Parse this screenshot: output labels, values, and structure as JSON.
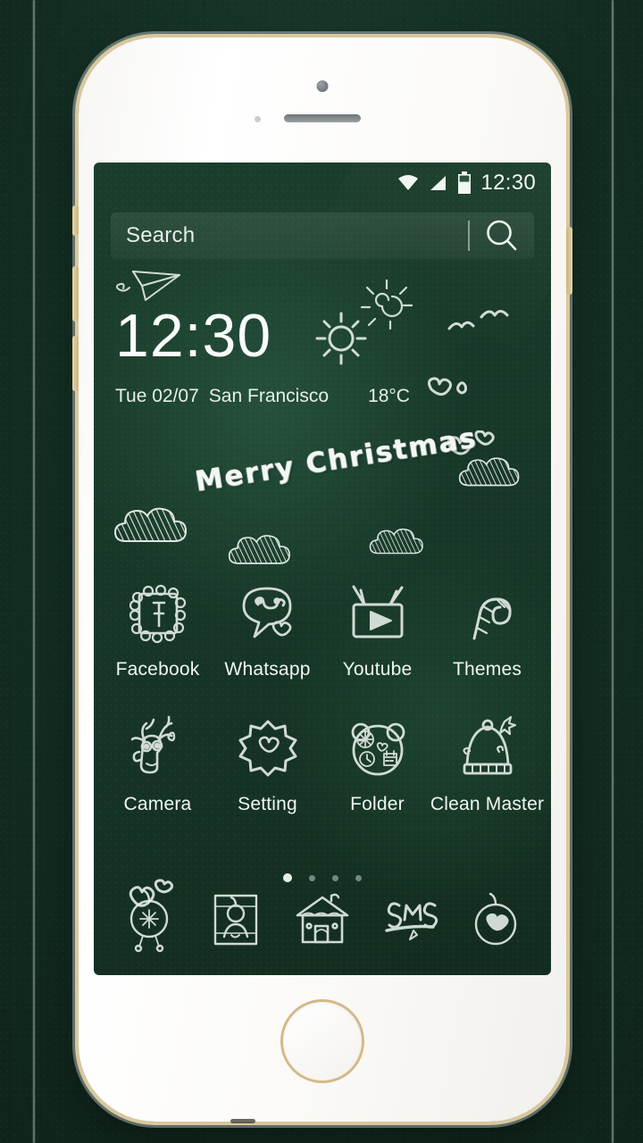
{
  "wallpaper": {
    "theme_name": "Merry Christmas",
    "board_color": "#143024",
    "chalk_color": "#eaf2ec"
  },
  "status_bar": {
    "time": "12:30",
    "icons": [
      "wifi-icon",
      "signal-icon",
      "battery-icon"
    ]
  },
  "search": {
    "placeholder": "Search",
    "value": "",
    "icon": "search-icon"
  },
  "clock_widget": {
    "time": "12:30",
    "date": "Tue  02/07",
    "city": "San Francisco",
    "temperature": "18°C",
    "weather_icon": "sun-icon"
  },
  "greeting": {
    "text": "Merry Christmas"
  },
  "app_grid": {
    "rows": [
      [
        {
          "label": "Facebook",
          "icon": "facebook-chalk-icon"
        },
        {
          "label": "Whatsapp",
          "icon": "whatsapp-chalk-icon"
        },
        {
          "label": "Youtube",
          "icon": "youtube-chalk-icon"
        },
        {
          "label": "Themes",
          "icon": "candy-cane-icon"
        }
      ],
      [
        {
          "label": "Camera",
          "icon": "reindeer-icon"
        },
        {
          "label": "Setting",
          "icon": "gear-heart-icon"
        },
        {
          "label": "Folder",
          "icon": "bear-face-icon"
        },
        {
          "label": "Clean Master",
          "icon": "santa-hat-icon"
        }
      ]
    ]
  },
  "page_indicator": {
    "count": 4,
    "active_index": 0
  },
  "dock": {
    "items": [
      {
        "name": "phone",
        "icon": "phone-ornament-icon"
      },
      {
        "name": "contacts",
        "icon": "contacts-frame-icon"
      },
      {
        "name": "home",
        "icon": "house-icon"
      },
      {
        "name": "messages",
        "icon": "sms-icon",
        "label": "SMS"
      },
      {
        "name": "browser",
        "icon": "heart-ornament-icon"
      }
    ]
  },
  "device": {
    "body_color": "#ffffff",
    "frame_accent": "#d3b987",
    "home_button": "home-button"
  }
}
